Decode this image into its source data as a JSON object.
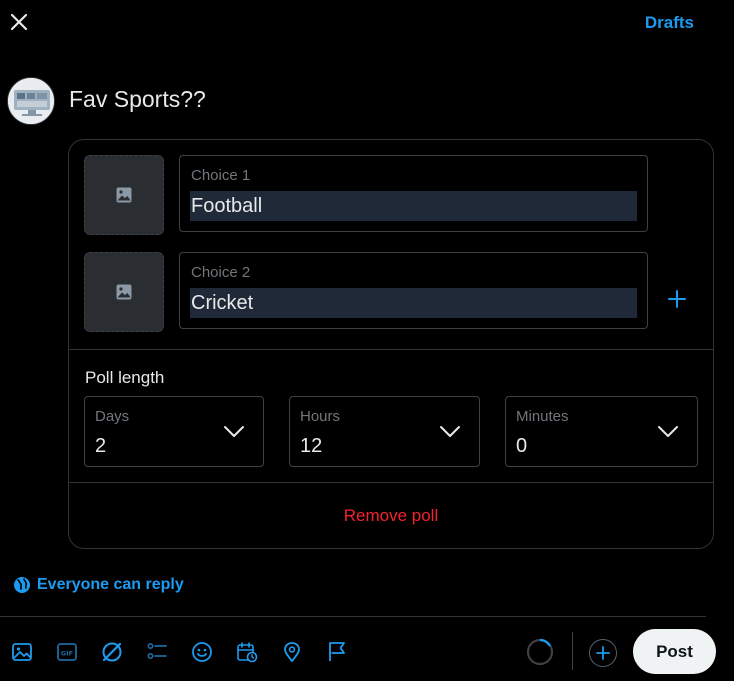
{
  "header": {
    "drafts_label": "Drafts"
  },
  "composer": {
    "text": "Fav Sports??"
  },
  "poll": {
    "choices": [
      {
        "label": "Choice 1",
        "value": "Football"
      },
      {
        "label": "Choice 2",
        "value": "Cricket"
      }
    ],
    "length_label": "Poll length",
    "days": {
      "label": "Days",
      "value": "2"
    },
    "hours": {
      "label": "Hours",
      "value": "12"
    },
    "minutes": {
      "label": "Minutes",
      "value": "0"
    },
    "remove_label": "Remove poll"
  },
  "reply_setting": {
    "label": "Everyone can reply"
  },
  "toolbar": {
    "icons": [
      "image-icon",
      "gif-icon",
      "poll-icon-disabled",
      "list-icon",
      "emoji-icon",
      "schedule-icon",
      "location-icon",
      "flag-icon"
    ],
    "post_label": "Post"
  },
  "colors": {
    "accent": "#1d9bf0",
    "danger": "#f4212e",
    "background": "#000000",
    "border": "#2f3336"
  }
}
